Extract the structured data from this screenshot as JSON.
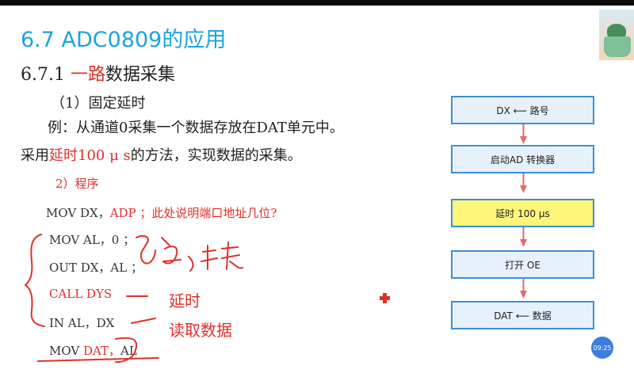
{
  "slide": {
    "title": "6.7 ADC0809的应用",
    "subtitle_prefix": "6.7.1 ",
    "subtitle_red": "一路",
    "subtitle_suffix": "数据采集",
    "section": "（1）固定延时",
    "example_line1": "例：从通道0采集一个数据存放在DAT单元中。",
    "example_line2_a": "采用",
    "example_line2_red": "延时100 μ s",
    "example_line2_b": "的方法，实现数据的采集。",
    "program_label": "2）程序"
  },
  "code": {
    "l1_a": "MOV  DX，",
    "l1_red": "ADP ；此处说明端口地址几位?",
    "l2": "MOV  AL，0 ；",
    "l3": "OUT  DX，AL ；",
    "l4": "CALL  DYS",
    "l5": "IN  AL，DX",
    "l6_a": "MOV  ",
    "l6_red": "DAT，",
    "l6_b": "AL"
  },
  "annotations": {
    "delay": "延时",
    "read_data": "读取数据"
  },
  "flowchart": {
    "steps": [
      {
        "label": "DX ⟵ 路号",
        "highlight": false
      },
      {
        "label": "启动AD 转换器",
        "highlight": false
      },
      {
        "label": "延时 100 μs",
        "highlight": true
      },
      {
        "label": "打开 OE",
        "highlight": false
      },
      {
        "label": "DAT ⟵ 数据",
        "highlight": false
      }
    ]
  },
  "overlay": {
    "time": "09:25",
    "accent_color": "#1aa4e0",
    "annotation_color": "#e0302a",
    "flow_border_color": "#3d8fd8"
  }
}
